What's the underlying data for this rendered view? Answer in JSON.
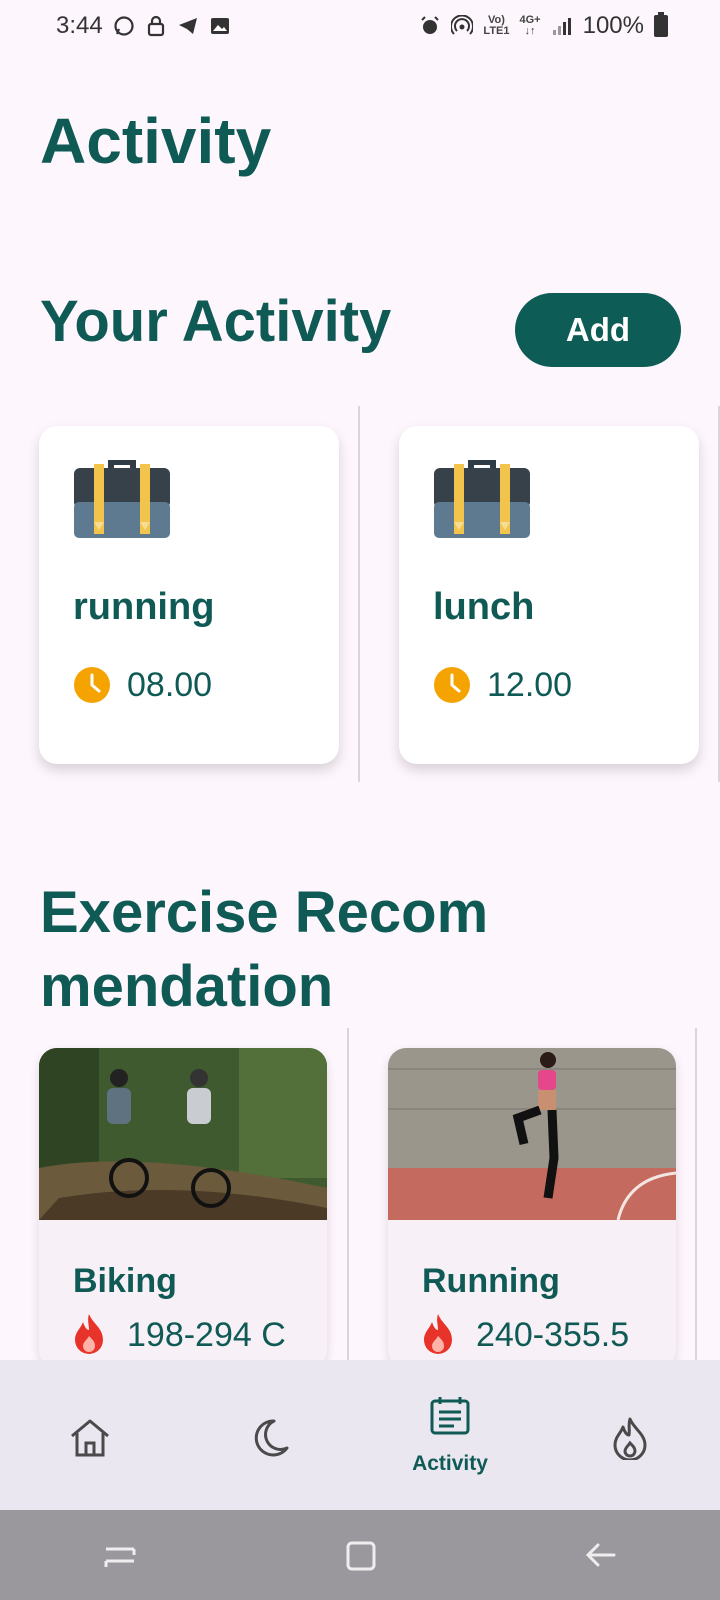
{
  "status_bar": {
    "time": "3:44",
    "volte_top": "Vo)",
    "volte_bottom": "LTE1",
    "network": "4G+",
    "battery": "100%"
  },
  "page": {
    "title": "Activity"
  },
  "your_activity": {
    "title": "Your Activity",
    "add_label": "Add",
    "cards": [
      {
        "label": "running",
        "time": "08.00",
        "icon": "briefcase-icon"
      },
      {
        "label": "lunch",
        "time": "12.00",
        "icon": "briefcase-icon"
      }
    ]
  },
  "exercise": {
    "title": "Exercise Recom mendation",
    "cards": [
      {
        "name": "Biking",
        "calories": "198-294 C",
        "icon": "fire-icon"
      },
      {
        "name": "Running",
        "calories": "240-355.5",
        "icon": "fire-icon"
      }
    ]
  },
  "bottom_nav": {
    "items": [
      {
        "icon": "home-icon",
        "label": ""
      },
      {
        "icon": "moon-icon",
        "label": ""
      },
      {
        "icon": "activity-icon",
        "label": "Activity"
      },
      {
        "icon": "flame-outline-icon",
        "label": ""
      }
    ],
    "active_index": 2
  },
  "colors": {
    "primary": "#0e5c56",
    "background": "#fdf6fc",
    "clock": "#f5a300",
    "fire": "#e8332a"
  }
}
